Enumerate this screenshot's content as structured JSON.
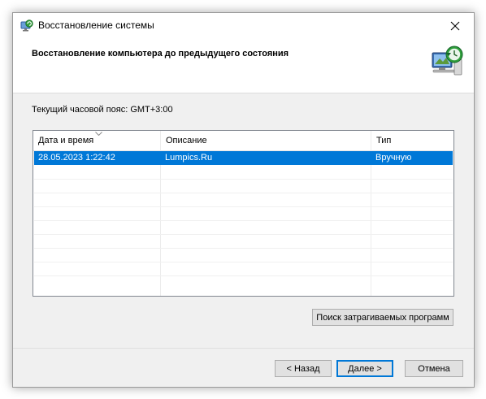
{
  "window": {
    "title": "Восстановление системы"
  },
  "header": {
    "title": "Восстановление компьютера до предыдущего состояния"
  },
  "timezone_label": "Текущий часовой пояс: GMT+3:00",
  "table": {
    "columns": [
      "Дата и время",
      "Описание",
      "Тип"
    ],
    "rows": [
      {
        "date": "28.05.2023 1:22:42",
        "description": "Lumpics.Ru",
        "type": "Вручную",
        "selected": true
      }
    ]
  },
  "buttons": {
    "scan": "Поиск затрагиваемых программ",
    "back": "< Назад",
    "next": "Далее >",
    "cancel": "Отмена"
  },
  "colors": {
    "selection": "#0078d7",
    "dialog_bg": "#f0f0f0"
  },
  "icons": {
    "title": "system-restore-icon",
    "header": "system-restore-computer-icon",
    "close": "close-icon",
    "sort": "sort-down-icon"
  }
}
